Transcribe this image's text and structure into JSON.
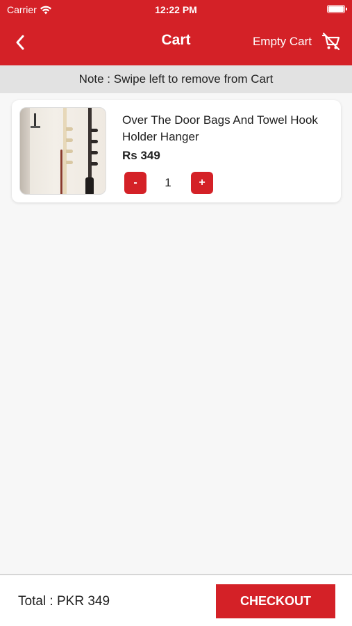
{
  "status_bar": {
    "carrier": "Carrier",
    "time": "12:22 PM"
  },
  "nav": {
    "title": "Cart",
    "empty_cart_label": "Empty Cart",
    "back_icon": "chevron-left-icon",
    "cart_icon": "cart-remove-icon"
  },
  "note": "Note : Swipe left to remove from Cart",
  "cart": {
    "items": [
      {
        "name": "Over The Door Bags And Towel Hook Holder Hanger",
        "price": "Rs 349",
        "quantity": "1",
        "minus_label": "-",
        "plus_label": "+"
      }
    ]
  },
  "footer": {
    "total": "Total : PKR 349",
    "checkout_label": "CHECKOUT"
  },
  "colors": {
    "brand_red": "#d42127",
    "note_background": "#e2e2e2",
    "page_background": "#f7f7f7"
  }
}
